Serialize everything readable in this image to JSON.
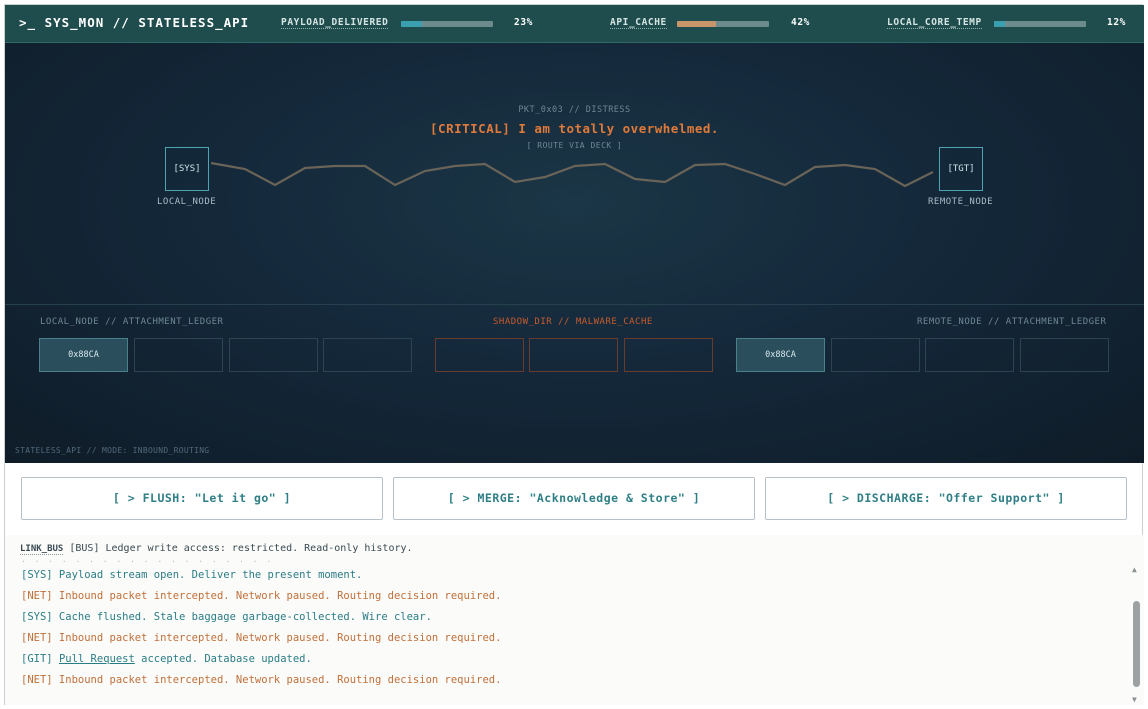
{
  "header": {
    "title": ">_ SYS_MON // STATELESS_API",
    "metrics": [
      {
        "label": "PAYLOAD_DELIVERED",
        "value": "23%",
        "fraction": 0.23,
        "color": "#3aa0b0"
      },
      {
        "label": "API_CACHE",
        "value": "42%",
        "fraction": 0.42,
        "color": "#c8956a"
      },
      {
        "label": "LOCAL_CORE_TEMP",
        "value": "12%",
        "fraction": 0.12,
        "color": "#3aa0b0"
      }
    ]
  },
  "packet": {
    "id": "PKT_0x03 // DISTRESS",
    "message": "[CRITICAL] I am totally overwhelmed.",
    "route": "[ ROUTE VIA DECK ]"
  },
  "nodes": {
    "local": {
      "box": "[SYS]",
      "label": "LOCAL_NODE"
    },
    "remote": {
      "box": "[TGT]",
      "label": "REMOTE_NODE"
    }
  },
  "ledgers": {
    "local": {
      "title": "LOCAL_NODE // ATTACHMENT_LEDGER",
      "slots": [
        "0x88CA",
        "",
        "",
        ""
      ]
    },
    "shadow": {
      "title": "SHADOW_DIR // MALWARE_CACHE",
      "slots": [
        "",
        "",
        ""
      ]
    },
    "remote": {
      "title": "REMOTE_NODE // ATTACHMENT_LEDGER",
      "slots": [
        "0x88CA",
        "",
        "",
        ""
      ]
    }
  },
  "mode_line": "STATELESS_API // MODE: INBOUND_ROUTING",
  "actions": [
    {
      "label": "[ > FLUSH: \"Let it go\" ]"
    },
    {
      "label": "[ > MERGE: \"Acknowledge & Store\" ]"
    },
    {
      "label": "[ > DISCHARGE: \"Offer Support\" ]"
    }
  ],
  "log": {
    "bus_tag": "LINK_BUS",
    "bus_text": "[BUS] Ledger write access: restricted. Read-only history.",
    "entries": [
      {
        "type": "sys",
        "text": "[SYS] Payload stream open. Deliver the present moment."
      },
      {
        "type": "net",
        "text": "[NET] Inbound packet intercepted. Network paused. Routing decision required."
      },
      {
        "type": "sys",
        "text": "[SYS] Cache flushed. Stale baggage garbage-collected. Wire clear."
      },
      {
        "type": "net",
        "text": "[NET] Inbound packet intercepted. Network paused. Routing decision required."
      },
      {
        "type": "git",
        "prefix": "[GIT] ",
        "link": "Pull Request",
        "suffix": " accepted. Database updated."
      },
      {
        "type": "net",
        "text": "[NET] Inbound packet intercepted. Network paused. Routing decision required."
      }
    ]
  },
  "colors": {
    "topbar": "#1f4d4d",
    "critical": "#e07a3a",
    "accent": "#2f7f86"
  }
}
